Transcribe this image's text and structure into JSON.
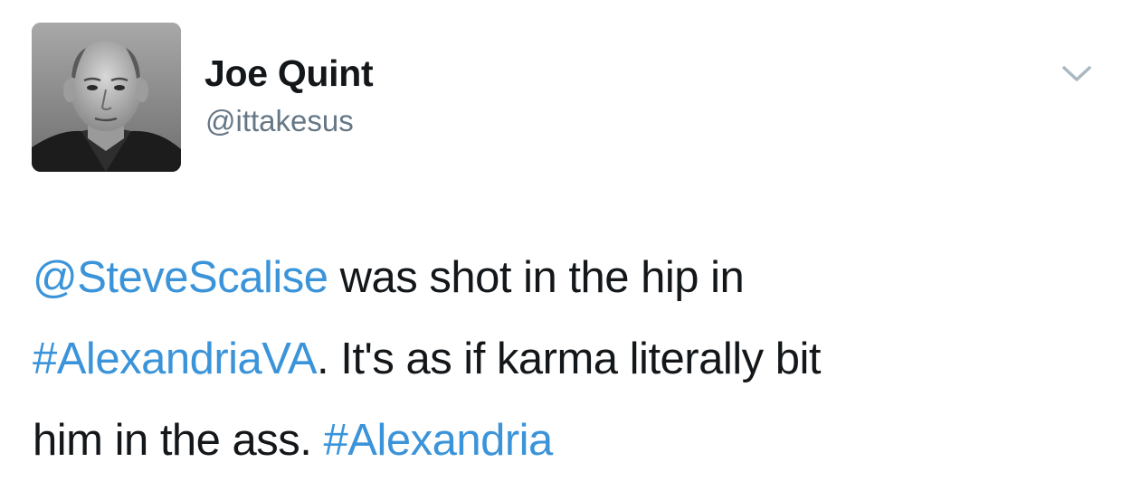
{
  "author": {
    "display_name": "Joe Quint",
    "handle": "@ittakesus",
    "avatar_icon": "profile-photo"
  },
  "menu": {
    "icon": "chevron-down-icon"
  },
  "tweet": {
    "lines": [
      [
        {
          "type": "mention",
          "text": "@SteveScalise"
        },
        {
          "type": "text",
          "text": " was shot in the hip in"
        }
      ],
      [
        {
          "type": "hashtag",
          "text": "#AlexandriaVA"
        },
        {
          "type": "text",
          "text": ". It's as if karma literally bit"
        }
      ],
      [
        {
          "type": "text",
          "text": "him in the ass. "
        },
        {
          "type": "hashtag",
          "text": "#Alexandria"
        }
      ]
    ]
  },
  "colors": {
    "link": "#3b94d9",
    "text": "#14171a",
    "secondary": "#657786",
    "chevron": "#aab8c2"
  }
}
